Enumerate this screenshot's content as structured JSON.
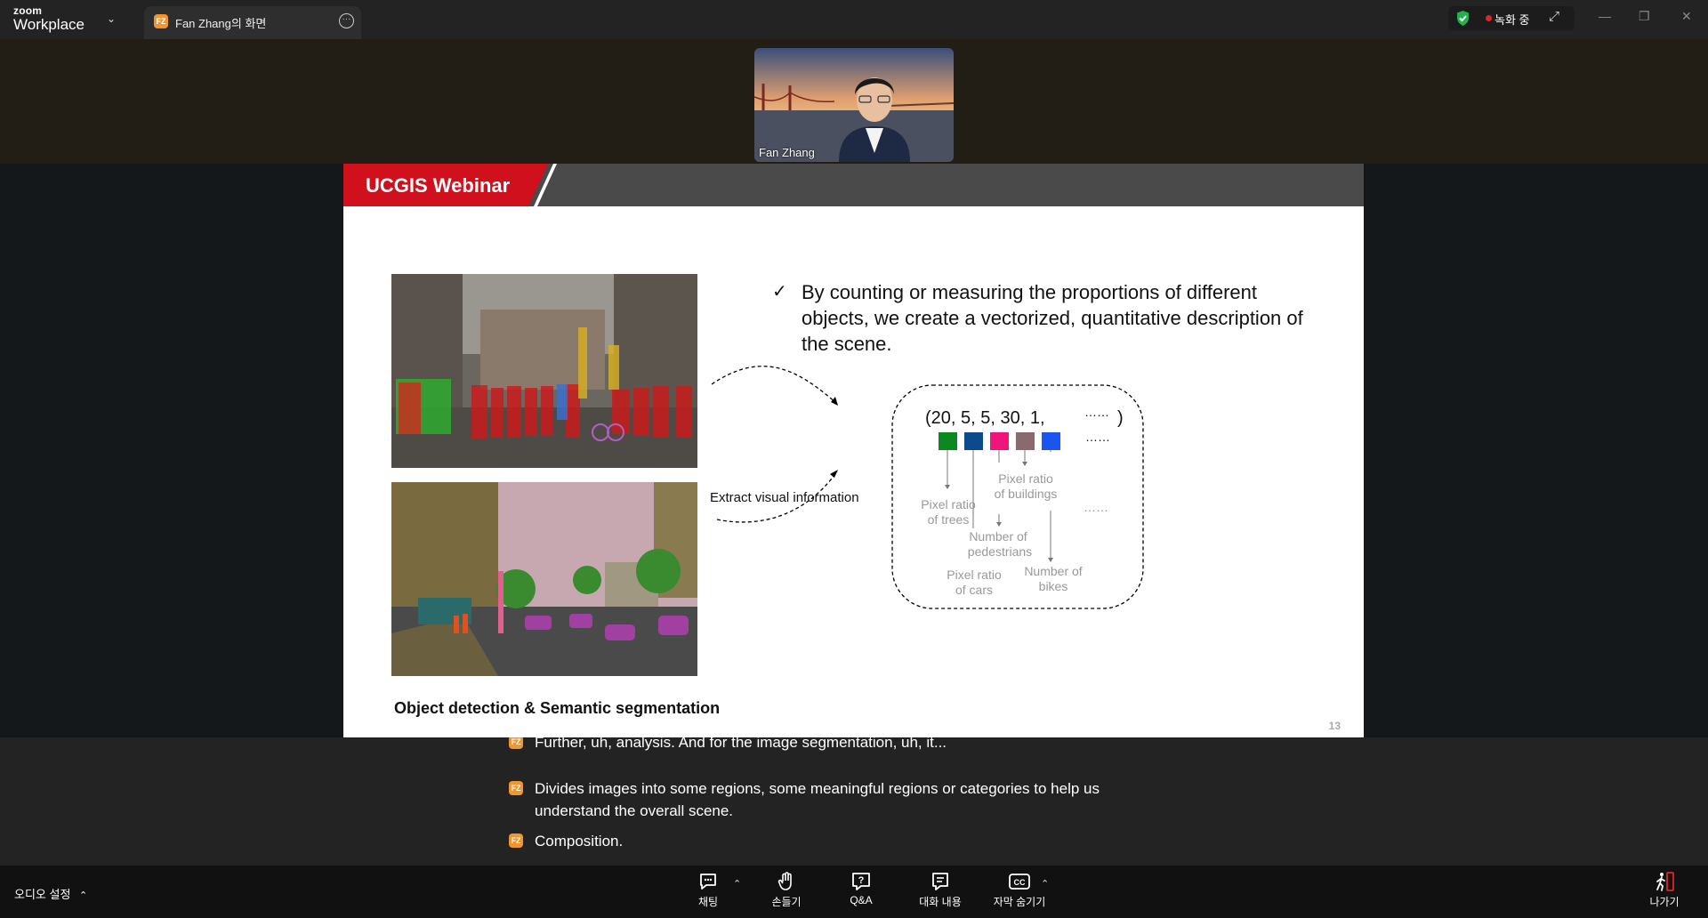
{
  "app": {
    "logo_top": "zoom",
    "logo_bottom": "Workplace",
    "tab_initials": "FZ",
    "tab_title": "Fan Zhang의 화면",
    "recording_label": "녹화 중"
  },
  "video": {
    "participant_name": "Fan Zhang"
  },
  "slide": {
    "header_title": "UCGIS Webinar",
    "bullet": "By counting or measuring the proportions of different objects, we create a vectorized, quantitative description of the scene.",
    "extract_label": "Extract visual information",
    "caption": "Object detection & Semantic segmentation",
    "page_number": "13",
    "vector_text": "(20, 5,  5, 30, 1,",
    "vector_ellipsis": "……",
    "vector_close": ")",
    "swatch_ellipsis": "……",
    "labels": {
      "trees": [
        "Pixel ratio",
        "of trees"
      ],
      "buildings": [
        "Pixel ratio",
        "of buildings"
      ],
      "pedestrians": [
        "Number of",
        "pedestrians"
      ],
      "cars": [
        "Pixel ratio",
        "of cars"
      ],
      "bikes": [
        "Number of",
        "bikes"
      ],
      "more": "……"
    },
    "swatch_colors": [
      "#0a8a1e",
      "#0d4a8c",
      "#f0157a",
      "#8a6a6e",
      "#1a55f0"
    ]
  },
  "captions": {
    "line1": "Further, uh, analysis. And for the image segmentation, uh, it...",
    "line2": "Divides images into some regions, some meaningful regions or categories to help us understand the overall scene.",
    "line3": "Composition."
  },
  "toolbar": {
    "audio_settings": "오디오 설정",
    "chat": "채팅",
    "raise_hand": "손들기",
    "qa": "Q&A",
    "transcript": "대화 내용",
    "hide_captions": "자막 숨기기",
    "leave": "나가기"
  }
}
